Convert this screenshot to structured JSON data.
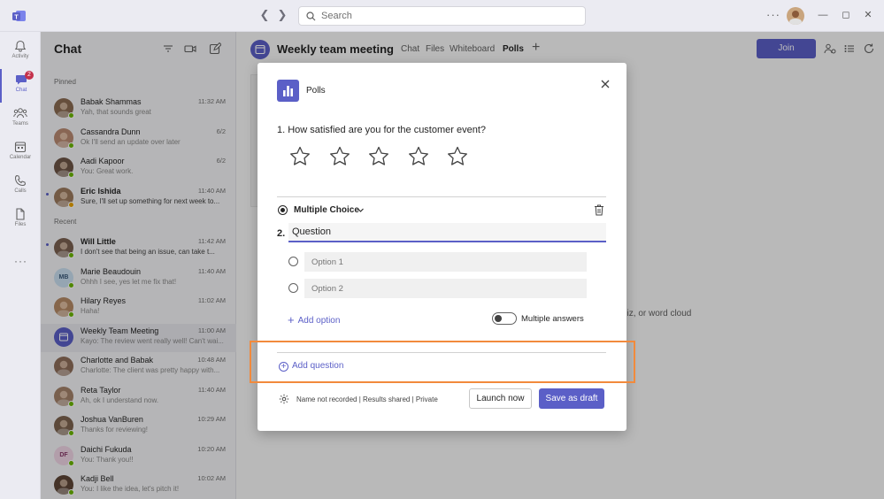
{
  "topbar": {
    "search_placeholder": "Search",
    "more": "···"
  },
  "rail": [
    {
      "label": "Activity",
      "icon": "bell-icon"
    },
    {
      "label": "Chat",
      "icon": "chat-icon",
      "badge": "2"
    },
    {
      "label": "Teams",
      "icon": "teams-icon"
    },
    {
      "label": "Calendar",
      "icon": "calendar-icon"
    },
    {
      "label": "Calls",
      "icon": "phone-icon"
    },
    {
      "label": "Files",
      "icon": "file-icon"
    }
  ],
  "rail_more": "···",
  "chatlist": {
    "title": "Chat",
    "pinned_label": "Pinned",
    "recent_label": "Recent",
    "pinned": [
      {
        "name": "Babak Shammas",
        "time": "11:32 AM",
        "preview": "Yah, that sounds great",
        "avatar_color": "#8a6b52",
        "presence": "available"
      },
      {
        "name": "Cassandra Dunn",
        "time": "6/2",
        "preview": "Ok I'll send an update over later",
        "avatar_color": "#b98a72",
        "presence": "available"
      },
      {
        "name": "Aadi Kapoor",
        "time": "6/2",
        "preview": "You: Great work.",
        "avatar_color": "#6d5446",
        "presence": "available"
      },
      {
        "name": "Eric Ishida",
        "time": "11:40 AM",
        "preview": "Sure, I'll set up something for next week to...",
        "avatar_color": "#9b7a5e",
        "presence": "away",
        "unread": true
      }
    ],
    "recent": [
      {
        "name": "Will Little",
        "time": "11:42 AM",
        "preview": "I don't see that being an issue, can take t...",
        "avatar_color": "#7a6050",
        "presence": "available",
        "unread": true
      },
      {
        "name": "Marie Beaudouin",
        "time": "11:40 AM",
        "preview": "Ohhh I see, yes let me fix that!",
        "initials": "MB",
        "avatar_color": "#c9dff0",
        "initials_color": "#3a5a7a",
        "presence": "available"
      },
      {
        "name": "Hilary Reyes",
        "time": "11:02 AM",
        "preview": "Haha!",
        "avatar_color": "#b58a66",
        "presence": "available"
      },
      {
        "name": "Weekly Team Meeting",
        "time": "11:00 AM",
        "preview": "Kayo: The review went really well! Can't wai...",
        "avatar_color": "#5b5fc7",
        "presence": "none",
        "selected": true,
        "meeting": true
      },
      {
        "name": "Charlotte and Babak",
        "time": "10:48 AM",
        "preview": "Charlotte: The client was pretty happy with...",
        "avatar_color": "#8e6e5a",
        "presence": "none"
      },
      {
        "name": "Reta Taylor",
        "time": "11:40 AM",
        "preview": "Ah, ok I understand now.",
        "avatar_color": "#a4826a",
        "presence": "available"
      },
      {
        "name": "Joshua VanBuren",
        "time": "10:29 AM",
        "preview": "Thanks for reviewing!",
        "avatar_color": "#7c634f",
        "presence": "available"
      },
      {
        "name": "Daichi Fukuda",
        "time": "10:20 AM",
        "preview": "You: Thank you!!",
        "initials": "DF",
        "avatar_color": "#f1d5e6",
        "initials_color": "#8a3a6a",
        "presence": "available"
      },
      {
        "name": "Kadji Bell",
        "time": "10:02 AM",
        "preview": "You: I like the idea, let's pitch it!",
        "avatar_color": "#5e4636",
        "presence": "available"
      }
    ]
  },
  "main": {
    "title": "Weekly team meeting",
    "tabs": [
      "Chat",
      "Files",
      "Whiteboard",
      "Polls"
    ],
    "active_tab": "Polls",
    "join_label": "Join",
    "background_text": "uiz, or word cloud"
  },
  "dialog": {
    "title": "Polls",
    "question1": "1.  How satisfied are you for the customer event?",
    "rating_stars": 5,
    "question_type": "Multiple Choice",
    "question2_number": "2.",
    "question2_value": "Question",
    "options": [
      {
        "value": "Option 1"
      },
      {
        "value": "Option 2"
      }
    ],
    "add_option": "Add option",
    "multiple_answers": "Multiple answers",
    "multiple_answers_on": false,
    "add_question": "Add question",
    "settings": "Name not recorded | Results shared | Private",
    "launch_label": "Launch now",
    "draft_label": "Save as draft"
  },
  "colors": {
    "brand": "#5b5fc7",
    "highlight": "#f28a3c",
    "presence_available": "#6bb700",
    "presence_away": "#eaa300"
  }
}
